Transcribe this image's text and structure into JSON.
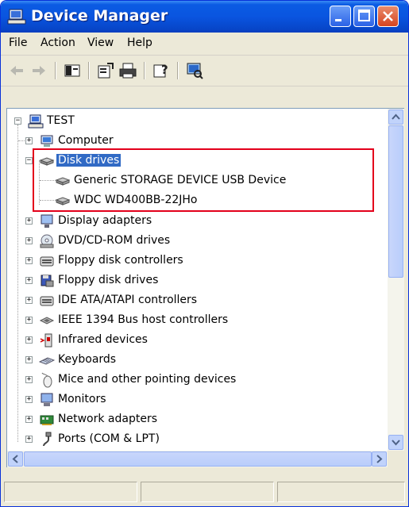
{
  "window": {
    "title": "Device Manager"
  },
  "menubar": {
    "items": [
      "File",
      "Action",
      "View",
      "Help"
    ]
  },
  "toolbar": {
    "buttons": [
      "back-icon",
      "forward-icon",
      "console-tree-icon",
      "properties-icon",
      "print-icon",
      "help-icon",
      "scan-hardware-icon"
    ]
  },
  "tree": {
    "root": "TEST",
    "items": [
      {
        "label": "Computer",
        "icon": "computer-icon",
        "expanded": false
      },
      {
        "label": "Disk drives",
        "icon": "disk-drive-icon",
        "expanded": true,
        "selected": true,
        "children": [
          "Generic STORAGE DEVICE USB Device",
          "WDC WD400BB-22JHo"
        ]
      },
      {
        "label": "Display adapters",
        "icon": "display-icon",
        "expanded": false
      },
      {
        "label": "DVD/CD-ROM drives",
        "icon": "cdrom-icon",
        "expanded": false
      },
      {
        "label": "Floppy disk controllers",
        "icon": "controller-icon",
        "expanded": false
      },
      {
        "label": "Floppy disk drives",
        "icon": "floppy-icon",
        "expanded": false
      },
      {
        "label": "IDE ATA/ATAPI controllers",
        "icon": "controller-icon",
        "expanded": false
      },
      {
        "label": "IEEE 1394 Bus host controllers",
        "icon": "firewire-icon",
        "expanded": false
      },
      {
        "label": "Infrared devices",
        "icon": "infrared-icon",
        "expanded": false
      },
      {
        "label": "Keyboards",
        "icon": "keyboard-icon",
        "expanded": false
      },
      {
        "label": "Mice and other pointing devices",
        "icon": "mouse-icon",
        "expanded": false
      },
      {
        "label": "Monitors",
        "icon": "monitor-icon",
        "expanded": false
      },
      {
        "label": "Network adapters",
        "icon": "network-icon",
        "expanded": false
      },
      {
        "label": "Ports (COM & LPT)",
        "icon": "port-icon",
        "expanded": false
      }
    ]
  },
  "colors": {
    "selection": "#316AC5",
    "highlight_border": "#E3001B",
    "titlebar": "#0A55E0"
  }
}
